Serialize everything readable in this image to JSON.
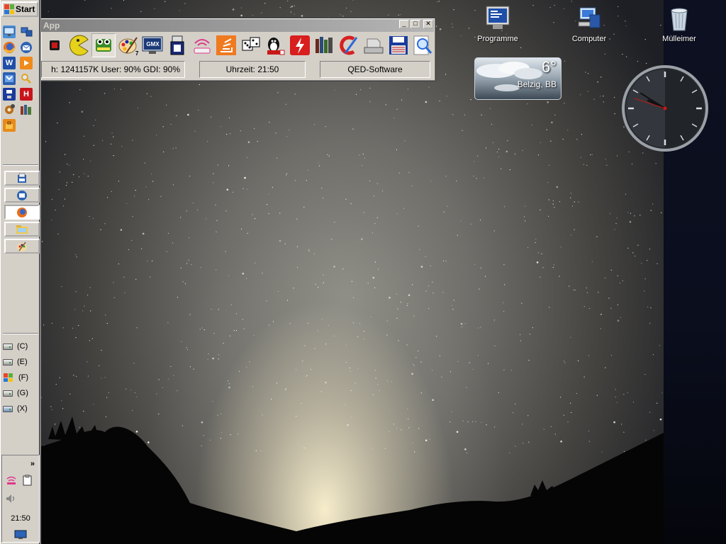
{
  "taskbar": {
    "start_label": "Start",
    "quick_launch": [
      {
        "name": "network-icon"
      },
      {
        "name": "computer-icon"
      },
      {
        "name": "firefox-icon"
      },
      {
        "name": "thunderbird-icon"
      },
      {
        "name": "word-icon",
        "glyph": "W"
      },
      {
        "name": "media-player-icon"
      },
      {
        "name": "yahoo-icon"
      },
      {
        "name": "search-icon"
      },
      {
        "name": "floppy-disk-icon"
      },
      {
        "name": "h-app-icon",
        "glyph": "H"
      },
      {
        "name": "gear-icon"
      },
      {
        "name": "books-icon"
      },
      {
        "name": "toolbox-icon"
      }
    ],
    "windows": [
      {
        "name": "window-button-file-manager"
      },
      {
        "name": "window-button-thunderbird"
      },
      {
        "name": "window-button-firefox"
      },
      {
        "name": "window-button-explorer"
      },
      {
        "name": "window-button-paint"
      }
    ],
    "drives": [
      {
        "label": "(C)"
      },
      {
        "label": "(E)"
      },
      {
        "label": "(F)"
      },
      {
        "label": "(G)"
      },
      {
        "label": "(X)"
      }
    ],
    "tray": {
      "chevron": "»",
      "time": "21:50"
    }
  },
  "app_window": {
    "title": "App",
    "controls": {
      "minimize": "_",
      "maximize": "□",
      "close": "✕"
    },
    "toolbar_buttons": [
      "stop-icon",
      "pacman-icon",
      "frog-icon",
      "paint-palette-icon",
      "gmx-icon",
      "usb-drive-icon",
      "wifi-icon",
      "stackoverflow-icon",
      "dice-icon",
      "linux-penguin-icon",
      "flash-icon",
      "bookshelf-icon",
      "ccleaner-icon",
      "scanner-icon",
      "save-icon",
      "magnifier-icon"
    ],
    "palette_badge": "7",
    "gmx_text": "GMX",
    "status": {
      "memory": "h: 1241157K  User: 90%  GDI: 90%",
      "time": "Uhrzeit: 21:50",
      "brand": "QED-Software"
    }
  },
  "desktop_icons": [
    {
      "label": "Programme",
      "icon": "programs-icon"
    },
    {
      "label": "Computer",
      "icon": "computer-icon"
    },
    {
      "label": "Mülleimer",
      "icon": "recycle-bin-icon"
    }
  ],
  "weather": {
    "temperature": "6°",
    "location": "Belzig, BB"
  },
  "clock": {
    "hour": 21,
    "minute": 50,
    "second": 18
  }
}
